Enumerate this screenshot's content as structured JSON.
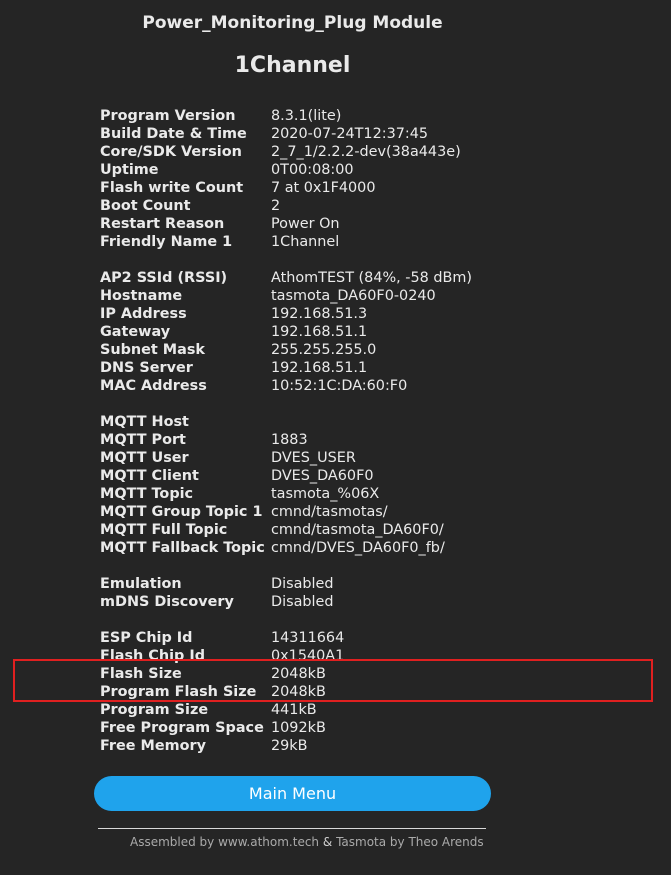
{
  "header": {
    "module_name": "Power_Monitoring_Plug Module",
    "device_name": "1Channel"
  },
  "info_sections": [
    [
      {
        "key": "Program Version",
        "value": "8.3.1(lite)"
      },
      {
        "key": "Build Date & Time",
        "value": "2020-07-24T12:37:45"
      },
      {
        "key": "Core/SDK Version",
        "value": "2_7_1/2.2.2-dev(38a443e)"
      },
      {
        "key": "Uptime",
        "value": "0T00:08:00"
      },
      {
        "key": "Flash write Count",
        "value": "7 at 0x1F4000"
      },
      {
        "key": "Boot Count",
        "value": "2"
      },
      {
        "key": "Restart Reason",
        "value": "Power On"
      },
      {
        "key": "Friendly Name 1",
        "value": "1Channel"
      }
    ],
    [
      {
        "key": "AP2 SSId (RSSI)",
        "value": "AthomTEST (84%, -58 dBm)"
      },
      {
        "key": "Hostname",
        "value": "tasmota_DA60F0-0240"
      },
      {
        "key": "IP Address",
        "value": "192.168.51.3"
      },
      {
        "key": "Gateway",
        "value": "192.168.51.1"
      },
      {
        "key": "Subnet Mask",
        "value": "255.255.255.0"
      },
      {
        "key": "DNS Server",
        "value": "192.168.51.1"
      },
      {
        "key": "MAC Address",
        "value": "10:52:1C:DA:60:F0"
      }
    ],
    [
      {
        "key": "MQTT Host",
        "value": ""
      },
      {
        "key": "MQTT Port",
        "value": "1883"
      },
      {
        "key": "MQTT User",
        "value": "DVES_USER"
      },
      {
        "key": "MQTT Client",
        "value": "DVES_DA60F0"
      },
      {
        "key": "MQTT Topic",
        "value": "tasmota_%06X"
      },
      {
        "key": "MQTT Group Topic 1",
        "value": "cmnd/tasmotas/"
      },
      {
        "key": "MQTT Full Topic",
        "value": "cmnd/tasmota_DA60F0/"
      },
      {
        "key": "MQTT Fallback Topic",
        "value": "cmnd/DVES_DA60F0_fb/"
      }
    ],
    [
      {
        "key": "Emulation",
        "value": "Disabled"
      },
      {
        "key": "mDNS Discovery",
        "value": "Disabled"
      }
    ],
    [
      {
        "key": "ESP Chip Id",
        "value": "14311664"
      },
      {
        "key": "Flash Chip Id",
        "value": "0x1540A1"
      },
      {
        "key": "Flash Size",
        "value": "2048kB"
      },
      {
        "key": "Program Flash Size",
        "value": "2048kB"
      },
      {
        "key": "Program Size",
        "value": "441kB"
      },
      {
        "key": "Free Program Space",
        "value": "1092kB"
      },
      {
        "key": "Free Memory",
        "value": "29kB"
      }
    ]
  ],
  "actions": {
    "main_menu_label": "Main Menu"
  },
  "footer": {
    "assembled_by": "Assembled by www.athom.tech",
    "separator": "&",
    "tasmota_credit": "Tasmota by Theo Arends"
  },
  "colors": {
    "background": "#252525",
    "text": "#eaeaea",
    "button": "#1fa3ec",
    "highlight": "#e02020"
  }
}
